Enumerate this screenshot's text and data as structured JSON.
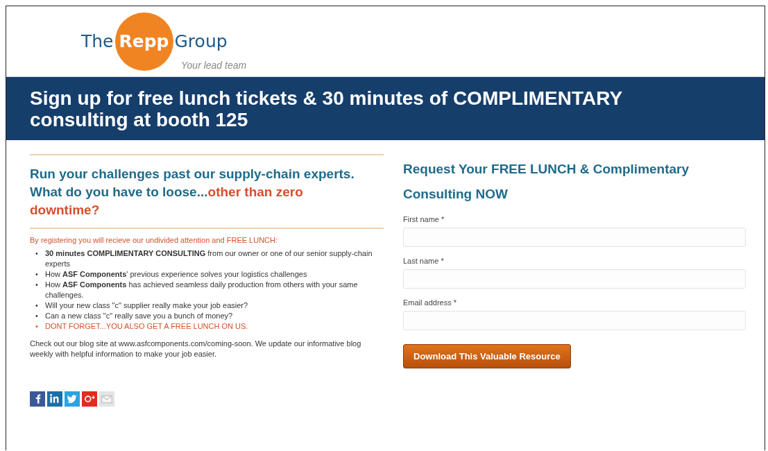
{
  "logo": {
    "before": "The",
    "circle": "Repp",
    "after": "Group",
    "tagline": "Your lead team"
  },
  "banner": {
    "title": "Sign up for free lunch tickets & 30 minutes of COMPLIMENTARY consulting at booth 125"
  },
  "pitch": {
    "heading": "Run your challenges past our supply-chain experts. What do you have to loose...",
    "heading_highlight": "other than zero downtime?",
    "intro": "By registering you will recieve our undivided attention and FREE LUNCH:",
    "bullets": [
      {
        "marker": "•",
        "text": "**30 minutes COMPLIMENTARY CONSULTING** from our owner or one of our senior supply-chain experts",
        "kind": "plain"
      },
      {
        "marker": "•",
        "text": "How **ASF Components**' previous experience solves your logistics challenges",
        "kind": "plain"
      },
      {
        "marker": "•",
        "text": "How **ASF Components** has achieved seamless daily production from others with your same challenges.",
        "kind": "plain"
      },
      {
        "marker": "•",
        "text": "Will your new class \"c\" supplier really make your job easier?",
        "kind": "plain"
      },
      {
        "marker": "•",
        "text": "Can a new class \"c\" really save you a bunch of money?",
        "kind": "plain"
      },
      {
        "marker": "•",
        "text": "DONT FORGET...YOU ALSO GET A FREE LUNCH ON US.",
        "kind": "alert"
      }
    ],
    "blog": "Check out our blog site at www.asfcomponents.com/coming-soon.  We update our informative blog weekly with helpful information to make your job easier.",
    "share_icons": [
      {
        "kind": "facebook"
      },
      {
        "kind": "linkedin"
      },
      {
        "kind": "twitter"
      },
      {
        "kind": "googleplus"
      },
      {
        "kind": "email"
      }
    ]
  },
  "form": {
    "title": "Request Your FREE LUNCH & Complimentary Consulting NOW",
    "fields": [
      {
        "label": "First name *"
      },
      {
        "label": "Last name *"
      },
      {
        "label": "Email address *"
      }
    ],
    "submit": "Download This Valuable Resource"
  }
}
